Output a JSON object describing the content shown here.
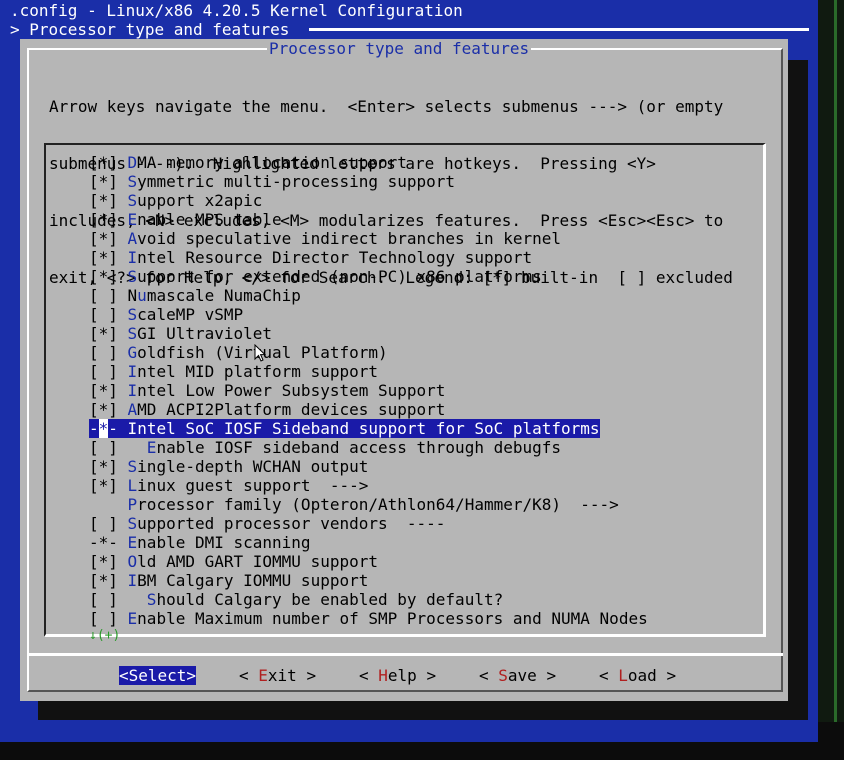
{
  "window": {
    "title": ".config - Linux/x86 4.20.5 Kernel Configuration",
    "breadcrumb": "> Processor type and features"
  },
  "dialog": {
    "title": "Processor type and features",
    "help": [
      "Arrow keys navigate the menu.  <Enter> selects submenus ---> (or empty",
      "submenus ----).  Highlighted letters are hotkeys.  Pressing <Y>",
      "includes, <N> excludes, <M> modularizes features.  Press <Esc><Esc> to",
      "exit, <?> for Help, </> for Search.  Legend: [*] built-in  [ ] excluded"
    ]
  },
  "menu": {
    "items": [
      {
        "prefix": "[*] ",
        "hotkey": "D",
        "rest": "MA memory allocation support"
      },
      {
        "prefix": "[*] ",
        "hotkey": "S",
        "rest": "ymmetric multi-processing support"
      },
      {
        "prefix": "[*] ",
        "hotkey": "S",
        "rest": "upport x2apic"
      },
      {
        "prefix": "[*] ",
        "hotkey": "E",
        "rest": "nable MPS table"
      },
      {
        "prefix": "[*] ",
        "hotkey": "A",
        "rest": "void speculative indirect branches in kernel"
      },
      {
        "prefix": "[*] ",
        "hotkey": "I",
        "rest": "ntel Resource Director Technology support"
      },
      {
        "prefix": "[*] ",
        "hotkey": "S",
        "rest": "upport for extended (non-PC) x86 platforms"
      },
      {
        "prefix": "[ ] N",
        "hotkey": "u",
        "rest": "mascale NumaChip"
      },
      {
        "prefix": "[ ] ",
        "hotkey": "S",
        "rest": "caleMP vSMP"
      },
      {
        "prefix": "[*] ",
        "hotkey": "S",
        "rest": "GI Ultraviolet"
      },
      {
        "prefix": "[ ] ",
        "hotkey": "G",
        "rest": "oldfish (Virtual Platform)"
      },
      {
        "prefix": "[ ] ",
        "hotkey": "I",
        "rest": "ntel MID platform support"
      },
      {
        "prefix": "[*] ",
        "hotkey": "I",
        "rest": "ntel Low Power Subsystem Support"
      },
      {
        "prefix": "[*] ",
        "hotkey": "A",
        "rest": "MD ACPI2Platform devices support"
      },
      {
        "prefix": "-*- ",
        "hotkey": "I",
        "rest": "ntel SoC IOSF Sideband support for SoC platforms",
        "selected": true
      },
      {
        "prefix": "[ ]   ",
        "hotkey": "E",
        "rest": "nable IOSF sideband access through debugfs"
      },
      {
        "prefix": "[*] ",
        "hotkey": "S",
        "rest": "ingle-depth WCHAN output"
      },
      {
        "prefix": "[*] ",
        "hotkey": "L",
        "rest": "inux guest support  --->"
      },
      {
        "prefix": "    ",
        "hotkey": "P",
        "rest": "rocessor family (Opteron/Athlon64/Hammer/K8)  --->"
      },
      {
        "prefix": "[ ] ",
        "hotkey": "S",
        "rest": "upported processor vendors  ----"
      },
      {
        "prefix": "-*- ",
        "hotkey": "E",
        "rest": "nable DMI scanning"
      },
      {
        "prefix": "[*] ",
        "hotkey": "O",
        "rest": "ld AMD GART IOMMU support"
      },
      {
        "prefix": "[*] ",
        "hotkey": "I",
        "rest": "BM Calgary IOMMU support"
      },
      {
        "prefix": "[ ]   ",
        "hotkey": "S",
        "rest": "hould Calgary be enabled by default?"
      },
      {
        "prefix": "[ ] ",
        "hotkey": "E",
        "rest": "nable Maximum number of SMP Processors and NUMA Nodes"
      }
    ],
    "more_indicator": "↓(+)"
  },
  "buttons": {
    "select": {
      "label": "<Select>"
    },
    "exit": {
      "pre": "< ",
      "hotkey": "E",
      "rest": "xit >"
    },
    "help": {
      "pre": "< ",
      "hotkey": "H",
      "rest": "elp >"
    },
    "save": {
      "pre": "< ",
      "hotkey": "S",
      "rest": "ave >"
    },
    "load": {
      "pre": "< ",
      "hotkey": "L",
      "rest": "oad >"
    }
  },
  "colors": {
    "terminal_bg": "#1a2ea8",
    "dialog_bg": "#b6b6b6",
    "hotkey": "#1a2ea8",
    "button_hotkey": "#b02020",
    "selection_bg": "#1a1aa8"
  }
}
